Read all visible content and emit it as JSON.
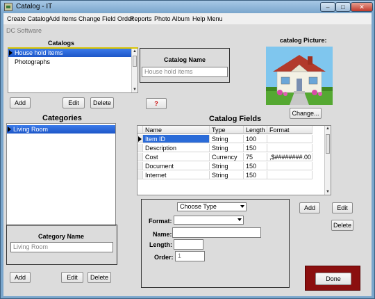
{
  "window": {
    "title": "Catalog - IT",
    "minimize": "–",
    "maximize": "□",
    "close": "✕"
  },
  "menu": [
    "Create Catalog",
    "Add Items",
    "Change Field Order",
    "Reports",
    "Photo Album",
    "Help Menu"
  ],
  "company": "DC Software",
  "catalogs": {
    "label": "Catalogs",
    "items": [
      "House hold items",
      "Photographs"
    ],
    "selected_index": 0,
    "add": "Add",
    "edit": "Edit",
    "delete": "Delete"
  },
  "catalog_name": {
    "label": "Catalog Name",
    "value": "House hold items",
    "help": "?"
  },
  "picture": {
    "label": "catalog Picture:",
    "change": "Change..."
  },
  "categories": {
    "label": "Categories",
    "items": [
      "Living Room"
    ],
    "add": "Add",
    "edit": "Edit",
    "delete": "Delete"
  },
  "category_name": {
    "label": "Category Name",
    "value": "Living Room"
  },
  "catalog_fields": {
    "label": "Catalog Fields",
    "columns": [
      "Name",
      "Type",
      "Length",
      "Format"
    ],
    "rows": [
      [
        "Item ID",
        "String",
        "100",
        ""
      ],
      [
        "Description",
        "String",
        "150",
        ""
      ],
      [
        "Cost",
        "Currency",
        "75",
        ",$########.00"
      ],
      [
        "Document",
        "String",
        "150",
        ""
      ],
      [
        "Internet",
        "String",
        "150",
        ""
      ]
    ],
    "add": "Add",
    "edit": "Edit",
    "delete": "Delete"
  },
  "field_editor": {
    "type_select": "Choose Type",
    "format_label": "Format:",
    "format_value": "",
    "name_label": "Name:",
    "name_value": "",
    "length_label": "Length:",
    "length_value": "",
    "order_label": "Order:",
    "order_value": "1"
  },
  "done": "Done",
  "colors": {
    "selection": "#1d56c8",
    "done_border": "#8b0f0f",
    "help_text": "#cc0000"
  }
}
